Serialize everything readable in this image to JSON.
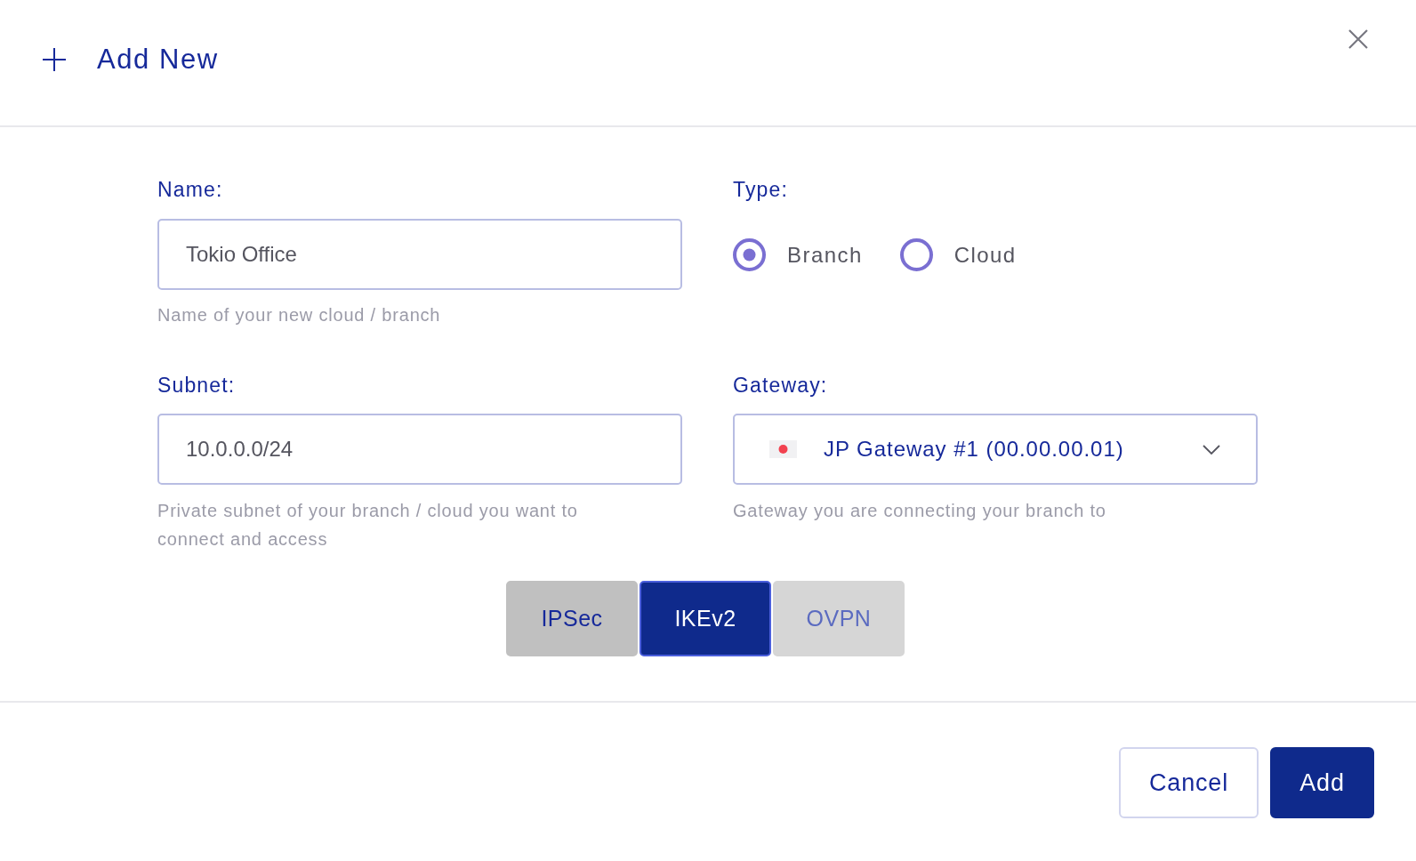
{
  "header": {
    "title": "Add New"
  },
  "form": {
    "name": {
      "label": "Name:",
      "value": "Tokio Office",
      "hint": "Name of your new cloud / branch"
    },
    "type": {
      "label": "Type:",
      "options": [
        {
          "label": "Branch",
          "selected": true
        },
        {
          "label": "Cloud",
          "selected": false
        }
      ]
    },
    "subnet": {
      "label": "Subnet:",
      "value": "10.0.0.0/24",
      "hint": "Private subnet of your branch / cloud you want to connect and access"
    },
    "gateway": {
      "label": "Gateway:",
      "value": "JP Gateway #1 (00.00.00.01)",
      "hint": "Gateway you are connecting your branch to"
    }
  },
  "protocols": [
    {
      "label": "IPSec",
      "selected": false,
      "disabled": false
    },
    {
      "label": "IKEv2",
      "selected": true,
      "disabled": false
    },
    {
      "label": "OVPN",
      "selected": false,
      "disabled": true
    }
  ],
  "buttons": [
    {
      "label": "Cancel",
      "kind": "secondary"
    },
    {
      "label": "Add",
      "kind": "primary"
    }
  ]
}
